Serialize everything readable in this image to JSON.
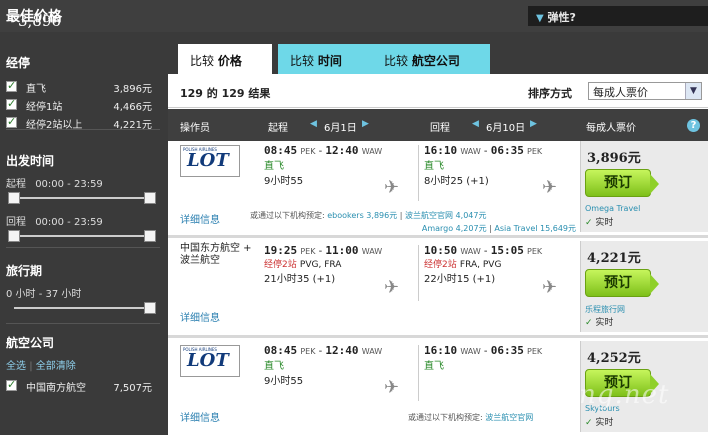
{
  "header": {
    "best_price_label": "最佳价格",
    "best_price_value": "3,896元",
    "flex_label": "弹性?"
  },
  "sidebar": {
    "stops": {
      "title": "经停",
      "items": [
        {
          "label": "直飞",
          "price": "3,896元"
        },
        {
          "label": "经停1站",
          "price": "4,466元"
        },
        {
          "label": "经停2站以上",
          "price": "4,221元"
        }
      ]
    },
    "departure_time": {
      "title": "出发时间",
      "outbound_label": "起程",
      "outbound_range": "00:00 - 23:59",
      "return_label": "回程",
      "return_range": "00:00 - 23:59"
    },
    "trip_length": {
      "title": "旅行期",
      "range": "0 小时 - 37 小时"
    },
    "airlines": {
      "title": "航空公司",
      "select_all": "全选",
      "clear_all": "全部清除",
      "items": [
        {
          "label": "中国南方航空",
          "price": "7,507元"
        }
      ]
    }
  },
  "tabs": {
    "price": {
      "prefix": "比较",
      "label": "价格"
    },
    "time": {
      "prefix": "比较",
      "label": "时间"
    },
    "airline": {
      "prefix": "比较",
      "label": "航空公司"
    }
  },
  "results": {
    "count": "129 的 129 结果",
    "sort_label": "排序方式",
    "sort_value": "每成人票价"
  },
  "columns": {
    "operator": "操作员",
    "depart": "起程",
    "depart_date": "6月1日",
    "return": "回程",
    "return_date": "6月10日",
    "price": "每成人票价",
    "help": "?"
  },
  "cards": [
    {
      "airline_logo": "LOT",
      "airline_logo_small": "POLISH AIRLINES",
      "out": {
        "dep_time": "08:45",
        "dep": "PEK",
        "arr_time": "12:40",
        "arr": "WAW",
        "stops": "直飞",
        "duration": "9小时55"
      },
      "ret": {
        "dep_time": "16:10",
        "dep": "WAW",
        "arr_time": "06:35",
        "arr": "PEK",
        "stops": "直飞",
        "duration": "8小时25 (+1)"
      },
      "detail": "详细信息",
      "also_label": "或通过以下机构预定:",
      "also_1": "ebookers 3,896元",
      "also_2": "波兰航空官网 4,047元",
      "also_3": "Amargo 4,207元",
      "also_4": "Asia Travel 15,649元",
      "price": "3,896元",
      "book": "预订",
      "agency": "Omega Travel",
      "realtime": "实时"
    },
    {
      "airline_text_1": "中国东方航空 +",
      "airline_text_2": "波兰航空",
      "out": {
        "dep_time": "19:25",
        "dep": "PEK",
        "arr_time": "11:00",
        "arr": "WAW",
        "stops": "经停2站",
        "via": "PVG, FRA",
        "duration": "21小时35 (+1)"
      },
      "ret": {
        "dep_time": "10:50",
        "dep": "WAW",
        "arr_time": "15:05",
        "arr": "PEK",
        "stops": "经停2站",
        "via": "FRA, PVG",
        "duration": "22小时15 (+1)"
      },
      "detail": "详细信息",
      "price": "4,221元",
      "book": "预订",
      "agency": "乐程旅行网",
      "realtime": "实时"
    },
    {
      "airline_logo": "LOT",
      "airline_logo_small": "POLISH AIRLINES",
      "out": {
        "dep_time": "08:45",
        "dep": "PEK",
        "arr_time": "12:40",
        "arr": "WAW",
        "stops": "直飞",
        "duration": "9小时55"
      },
      "ret": {
        "dep_time": "16:10",
        "dep": "WAW",
        "arr_time": "06:35",
        "arr": "PEK",
        "stops": "直飞",
        "duration": ""
      },
      "detail": "详细信息",
      "also_label": "或通过以下机构预定:",
      "also_1": "波兰航空官网",
      "price": "4,252元",
      "book": "预订",
      "agency": "Skytours",
      "realtime": "实时"
    }
  ],
  "watermark": "eLvXing.net",
  "colors": {
    "accent": "#6ed8e8",
    "book_green": "#8fd02a",
    "direct_green": "#2a8a2a",
    "stops_red": "#cc3333",
    "link": "#2a8fb0"
  }
}
